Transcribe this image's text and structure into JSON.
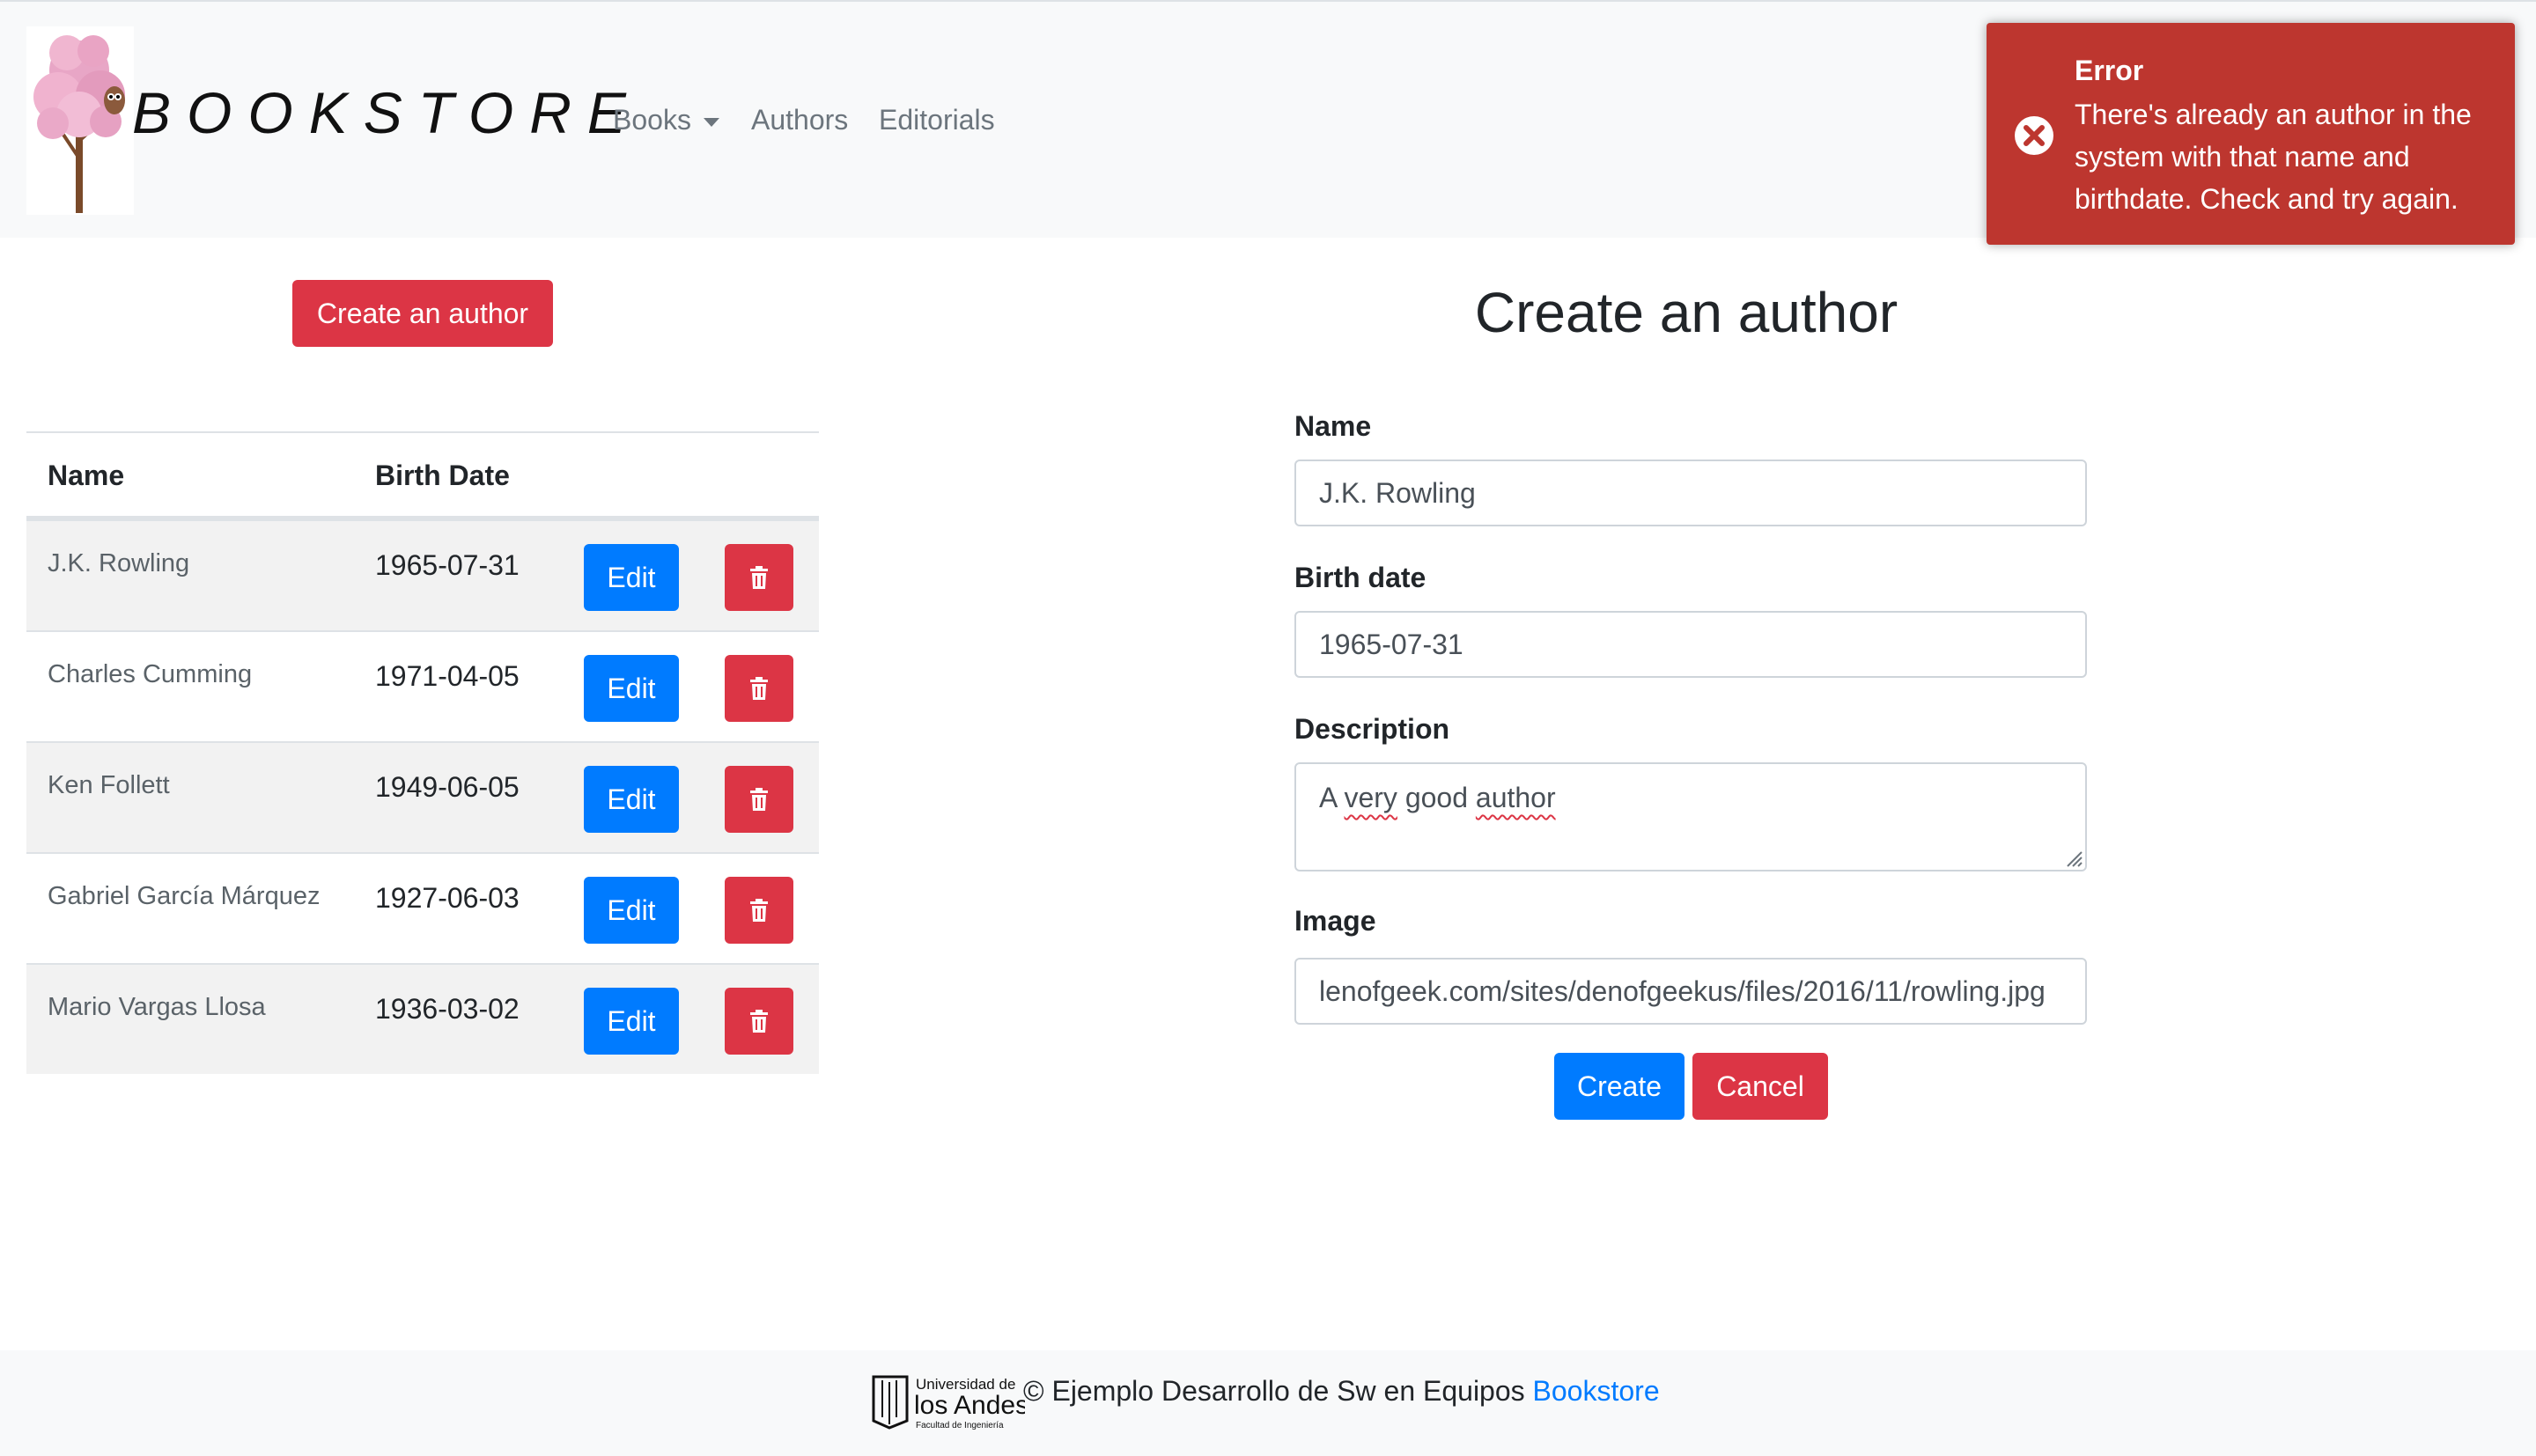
{
  "navbar": {
    "brand": "BOOKSTORE",
    "items": [
      {
        "label": "Books",
        "has_dropdown": true
      },
      {
        "label": "Authors"
      },
      {
        "label": "Editorials"
      }
    ]
  },
  "toast": {
    "title": "Error",
    "message": "There's already an author in the system with that name and birthdate. Check and try again.",
    "icon": "error-circle-icon",
    "color": "#bd362f"
  },
  "left": {
    "create_button": "Create an author",
    "table": {
      "headers": [
        "Name",
        "Birth Date"
      ],
      "rows": [
        {
          "name": "J.K. Rowling",
          "birth_date": "1965-07-31"
        },
        {
          "name": "Charles Cumming",
          "birth_date": "1971-04-05"
        },
        {
          "name": "Ken Follett",
          "birth_date": "1949-06-05"
        },
        {
          "name": "Gabriel García Márquez",
          "birth_date": "1927-06-03"
        },
        {
          "name": "Mario Vargas Llosa",
          "birth_date": "1936-03-02"
        }
      ],
      "edit_label": "Edit",
      "delete_icon": "trash-icon"
    }
  },
  "form": {
    "title": "Create an author",
    "name_label": "Name",
    "name_value": "J.K. Rowling",
    "birth_label": "Birth date",
    "birth_value": "1965-07-31",
    "description_label": "Description",
    "description_words": [
      "A",
      "very",
      "good",
      "author"
    ],
    "image_label": "Image",
    "image_value": "lenofgeek.com/sites/denofgeekus/files/2016/11/rowling.jpg",
    "create_button": "Create",
    "cancel_button": "Cancel"
  },
  "footer": {
    "logo_line1": "Universidad de",
    "logo_line2": "los Andes",
    "logo_line3": "Facultad de Ingeniería",
    "text": "© Ejemplo Desarrollo de Sw en Equipos",
    "link": "Bookstore"
  },
  "colors": {
    "primary": "#007bff",
    "danger": "#dc3545",
    "navbar_bg": "#f8f9fa",
    "toast_bg": "#bd362f"
  }
}
